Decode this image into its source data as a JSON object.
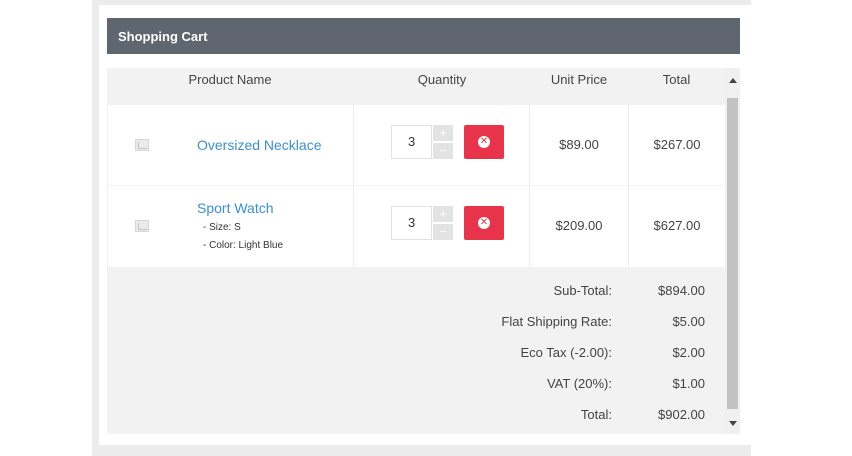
{
  "cart": {
    "title": "Shopping Cart",
    "columns": {
      "product": "Product Name",
      "quantity": "Quantity",
      "unit_price": "Unit Price",
      "total": "Total"
    },
    "items": [
      {
        "name": "Oversized Necklace",
        "options": [],
        "quantity": "3",
        "unit_price": "$89.00",
        "total": "$267.00"
      },
      {
        "name": "Sport Watch",
        "options": [
          "- Size: S",
          "- Color: Light Blue"
        ],
        "quantity": "3",
        "unit_price": "$209.00",
        "total": "$627.00"
      }
    ],
    "summary": [
      {
        "label": "Sub-Total:",
        "value": "$894.00"
      },
      {
        "label": "Flat Shipping Rate:",
        "value": "$5.00"
      },
      {
        "label": "Eco Tax (-2.00):",
        "value": "$2.00"
      },
      {
        "label": "VAT (20%):",
        "value": "$1.00"
      },
      {
        "label": "Total:",
        "value": "$902.00"
      }
    ],
    "qty_plus": "+",
    "qty_minus": "−",
    "remove_glyph": "✕",
    "colors": {
      "header_bg": "#5f6670",
      "link": "#3a8fd8",
      "remove": "#e7344a"
    }
  }
}
